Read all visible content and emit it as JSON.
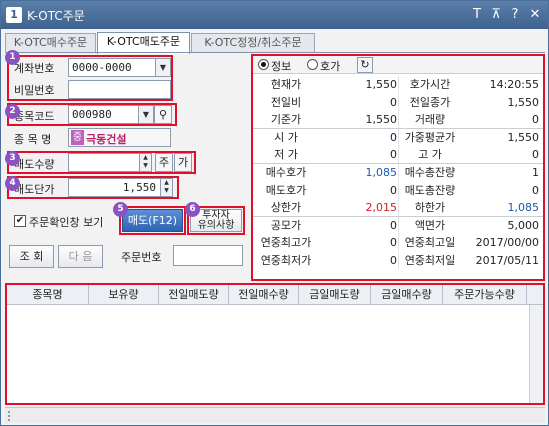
{
  "window": {
    "app_icon": "1",
    "title": "K-OTC주문",
    "buttons": [
      "T",
      "⊼",
      "?",
      "✕"
    ]
  },
  "tabs": [
    {
      "label": "K-OTC매수주문"
    },
    {
      "label": "K-OTC매도주문"
    },
    {
      "label": "K-OTC정정/취소주문"
    }
  ],
  "form": {
    "account_label": "계좌번호",
    "account_value": "0000-0000",
    "password_label": "비밀번호",
    "password_value": "",
    "code_label": "종목코드",
    "code_value": "000980",
    "name_label": "종 목 명",
    "name_badge": "중",
    "name_value": "극동건설",
    "qty_label": "매도수량",
    "qty_value": "",
    "qty_unit": "주",
    "qty_btn": "가",
    "price_label": "매도단가",
    "price_value": "1,550",
    "confirm_label": "주문확인창 보기",
    "confirm_checked": true,
    "sell_button": "매도(F12)",
    "notice_button": "투자자\n유의사항",
    "search_button": "조 회",
    "next_button": "다 음",
    "order_no_label": "주문번호",
    "order_no_value": ""
  },
  "badges": [
    "1",
    "2",
    "3",
    "4",
    "5",
    "6"
  ],
  "quote": {
    "radio_info": "정보",
    "radio_quote": "호가",
    "rows": [
      {
        "l1": "현재가",
        "v1": "1,550",
        "c1": "",
        "l2": "호가시간",
        "v2": "14:20:55",
        "c2": ""
      },
      {
        "l1": "전일비",
        "v1": "0",
        "c1": "",
        "l2": "전일종가",
        "v2": "1,550",
        "c2": ""
      },
      {
        "l1": "기준가",
        "v1": "1,550",
        "c1": "",
        "l2": "거래량",
        "v2": "0",
        "c2": ""
      },
      {
        "l1": "시    가",
        "v1": "0",
        "c1": "",
        "l2": "가중평균가",
        "v2": "1,550",
        "c2": ""
      },
      {
        "l1": "저    가",
        "v1": "0",
        "c1": "",
        "l2": "고    가",
        "v2": "0",
        "c2": ""
      },
      {
        "l1": "매수호가",
        "v1": "1,085",
        "c1": "blue",
        "l2": "매수총잔량",
        "v2": "1",
        "c2": ""
      },
      {
        "l1": "매도호가",
        "v1": "0",
        "c1": "",
        "l2": "매도총잔량",
        "v2": "0",
        "c2": ""
      },
      {
        "l1": "상한가",
        "v1": "2,015",
        "c1": "red",
        "l2": "하한가",
        "v2": "1,085",
        "c2": "blue"
      },
      {
        "l1": "공모가",
        "v1": "0",
        "c1": "",
        "l2": "액면가",
        "v2": "5,000",
        "c2": ""
      },
      {
        "l1": "연중최고가",
        "v1": "0",
        "c1": "",
        "l2": "연중최고일",
        "v2": "2017/00/00",
        "c2": ""
      },
      {
        "l1": "연중최저가",
        "v1": "0",
        "c1": "",
        "l2": "연중최저일",
        "v2": "2017/05/11",
        "c2": ""
      }
    ]
  },
  "holdings": {
    "columns": [
      "종목명",
      "보유량",
      "전일매도량",
      "전일매수량",
      "금일매도량",
      "금일매수량",
      "주문가능수량"
    ]
  },
  "colors": {
    "highlight": "#e0102a",
    "badge": "#8a52c2",
    "blue_value": "#1a5aaa",
    "red_value": "#d0202a"
  }
}
